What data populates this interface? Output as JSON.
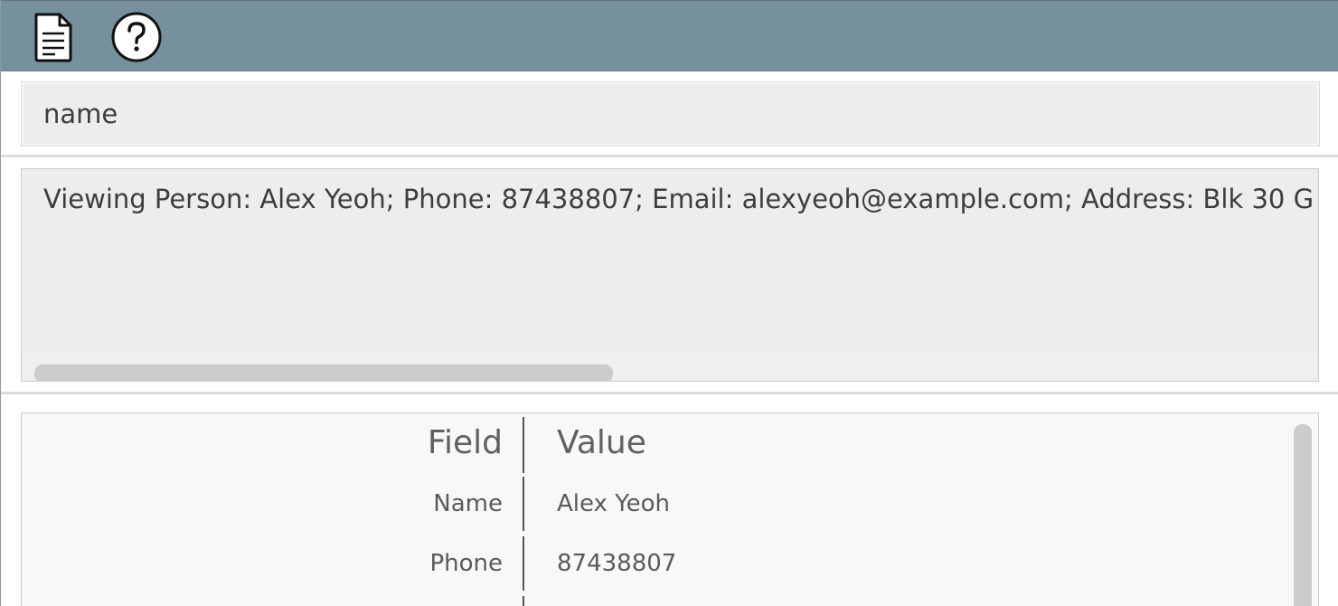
{
  "toolbar": {
    "icons": [
      "document-icon",
      "help-icon"
    ]
  },
  "command": {
    "value": "name"
  },
  "result": {
    "text": "Viewing Person: Alex Yeoh; Phone: 87438807; Email: alexyeoh@example.com; Address: Blk 30 G"
  },
  "details": {
    "headers": {
      "field": "Field",
      "value": "Value"
    },
    "rows": [
      {
        "label": "Name",
        "value": "Alex Yeoh"
      },
      {
        "label": "Phone",
        "value": "87438807"
      }
    ]
  },
  "colors": {
    "toolbar_bg": "#77909d",
    "input_bg": "#eceeed",
    "table_bg": "#f8f8f8",
    "text": "#3d3d3d",
    "scrollbar": "#cbcbcb"
  }
}
